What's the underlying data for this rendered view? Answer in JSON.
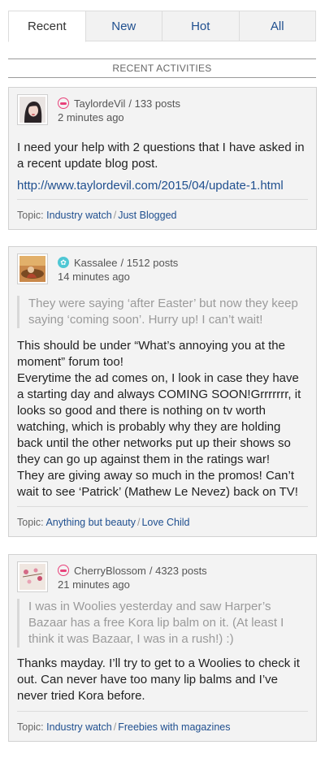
{
  "tabs": [
    {
      "label": "Recent",
      "active": true
    },
    {
      "label": "New",
      "active": false
    },
    {
      "label": "Hot",
      "active": false
    },
    {
      "label": "All",
      "active": false
    }
  ],
  "section_title": "RECENT ACTIVITIES",
  "topic_prefix": "Topic:",
  "posts": [
    {
      "username": "TaylordeVil",
      "post_count": "/ 133 posts",
      "time": "2 minutes ago",
      "badge_icon": "lips-icon",
      "avatar_icon": "avatar-woman",
      "quote": "",
      "body": "I need your help with 2 questions that I have asked in a recent update blog post.",
      "link": "http://www.taylordevil.com/2015/04/update-1.html",
      "topic_forum": "Industry watch",
      "topic_thread": "Just Blogged"
    },
    {
      "username": "Kassalee",
      "post_count": "/ 1512 posts",
      "time": "14 minutes ago",
      "badge_icon": "flower-icon",
      "avatar_icon": "avatar-sunset",
      "quote": "They were saying ‘after Easter’ but now they keep saying ‘coming soon’. Hurry up! I can’t wait!",
      "body": "This should be under “What’s annoying you at the moment” forum too!\nEverytime the ad comes on, I look in case they have a starting day and always COMING SOON!Grrrrrrr, it looks so good and there is nothing on tv worth watching, which is probably why they are holding back until the other networks put up their shows so they can go up against them in the ratings war!\nThey are giving away so much in the promos! Can’t wait to see ‘Patrick’ (Mathew Le Nevez) back on TV!",
      "link": "",
      "topic_forum": "Anything but beauty",
      "topic_thread": "Love Child"
    },
    {
      "username": "CherryBlossom",
      "post_count": "/ 4323 posts",
      "time": "21 minutes ago",
      "badge_icon": "lips-icon",
      "avatar_icon": "avatar-blossom",
      "quote": "I was in Woolies yesterday and saw Harper’s Bazaar has a free Kora lip balm on it. (At least I think it was Bazaar, I was in a rush!) :)",
      "body": "Thanks mayday. I’ll try to get to a Woolies to check it out. Can never have too many lip balms and I’ve never tried Kora before.",
      "link": "",
      "topic_forum": "Industry watch",
      "topic_thread": "Freebies with magazines"
    }
  ]
}
